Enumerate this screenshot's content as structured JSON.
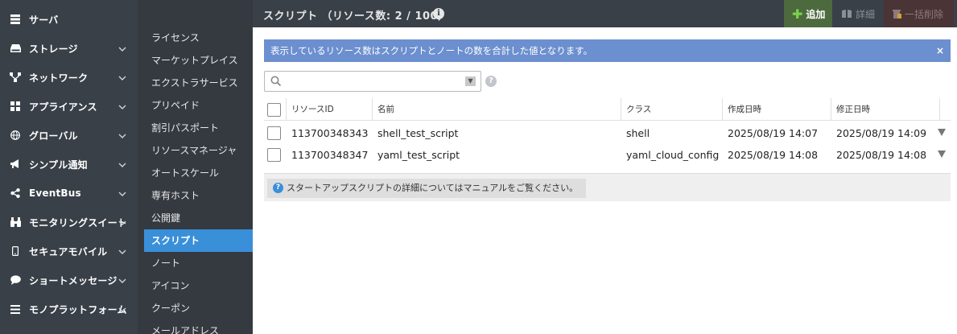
{
  "colors": {
    "nav_bg": "#3a4048",
    "subnav_bg": "#353a41",
    "active_bg": "#3a8fd9",
    "notice_bg": "#6c8fcf",
    "add_bg": "#4d6a3e",
    "delete_bg": "#4a3436"
  },
  "main_nav": [
    {
      "label": "サーバ",
      "icon": "server-icon",
      "expandable": false
    },
    {
      "label": "ストレージ",
      "icon": "disk-icon",
      "expandable": true
    },
    {
      "label": "ネットワーク",
      "icon": "network-icon",
      "expandable": true
    },
    {
      "label": "アプライアンス",
      "icon": "grid-icon",
      "expandable": true
    },
    {
      "label": "グローバル",
      "icon": "globe-icon",
      "expandable": true
    },
    {
      "label": "シンプル通知",
      "icon": "megaphone-icon",
      "expandable": true
    },
    {
      "label": "EventBus",
      "icon": "share-icon",
      "expandable": true
    },
    {
      "label": "モニタリングスイート",
      "icon": "binoculars-icon",
      "expandable": true
    },
    {
      "label": "セキュアモバイル",
      "icon": "mobile-icon",
      "expandable": true
    },
    {
      "label": "ショートメッセージ",
      "icon": "chat-icon",
      "expandable": true
    },
    {
      "label": "モノプラットフォーム",
      "icon": "list-icon",
      "expandable": true
    }
  ],
  "sub_nav": [
    {
      "label": "ライセンス",
      "active": false
    },
    {
      "label": "マーケットプレイス",
      "active": false
    },
    {
      "label": "エクストラサービス",
      "active": false
    },
    {
      "label": "プリペイド",
      "active": false
    },
    {
      "label": "割引パスポート",
      "active": false
    },
    {
      "label": "リソースマネージャ",
      "active": false
    },
    {
      "label": "オートスケール",
      "active": false
    },
    {
      "label": "専有ホスト",
      "active": false
    },
    {
      "label": "公開鍵",
      "active": false
    },
    {
      "label": "スクリプト",
      "active": true
    },
    {
      "label": "ノート",
      "active": false
    },
    {
      "label": "アイコン",
      "active": false
    },
    {
      "label": "クーポン",
      "active": false
    },
    {
      "label": "メールアドレス",
      "active": false
    }
  ],
  "topbar": {
    "title": "スクリプト （リソース数: 2 / 100）",
    "info_icon": "info-icon",
    "add_label": "追加",
    "detail_label": "詳細",
    "delete_label": "一括削除"
  },
  "notice": {
    "text": "表示しているリソース数はスクリプトとノートの数を合計した値となります。",
    "close": "×"
  },
  "search": {
    "value": "",
    "placeholder": "",
    "help_icon": "?"
  },
  "table": {
    "columns": [
      "リソースID",
      "名前",
      "クラス",
      "作成日時",
      "修正日時"
    ],
    "rows": [
      {
        "id": "113700348343",
        "name": "shell_test_script",
        "class": "shell",
        "created": "2025/08/19 14:07",
        "modified": "2025/08/19 14:09"
      },
      {
        "id": "113700348347",
        "name": "yaml_test_script",
        "class": "yaml_cloud_config",
        "created": "2025/08/19 14:08",
        "modified": "2025/08/19 14:08"
      }
    ]
  },
  "footer": {
    "note": "スタートアップスクリプトの詳細についてはマニュアルをご覧ください。",
    "help_icon": "?"
  }
}
